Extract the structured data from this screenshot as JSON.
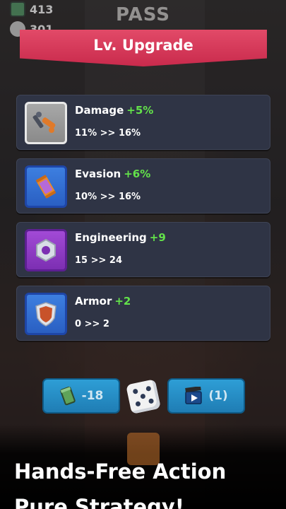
{
  "header": {
    "resource_1": "413",
    "resource_2": "301",
    "pass_label": "PASS"
  },
  "dialog": {
    "title": "Lv. Upgrade",
    "upgrades": [
      {
        "name": "Damage",
        "bonus": "+5%",
        "range": "11% >> 16%",
        "icon": "wrench-gun-icon"
      },
      {
        "name": "Evasion",
        "bonus": "+6%",
        "range": "10% >> 16%",
        "icon": "canister-icon"
      },
      {
        "name": "Engineering",
        "bonus": "+9",
        "range": "15 >> 24",
        "icon": "hex-nut-icon"
      },
      {
        "name": "Armor",
        "bonus": "+2",
        "range": "0 >> 2",
        "icon": "shield-icon"
      }
    ]
  },
  "actions": {
    "reroll_cost": "-18",
    "video_count": "(1)"
  },
  "promo": {
    "line1": "Hands-Free Action",
    "line2": "Pure Strategy!"
  },
  "colors": {
    "banner": "#d4385a",
    "bonus_green": "#63e24a",
    "button_blue": "#2a8fc9",
    "card_bg": "#2f3445"
  }
}
